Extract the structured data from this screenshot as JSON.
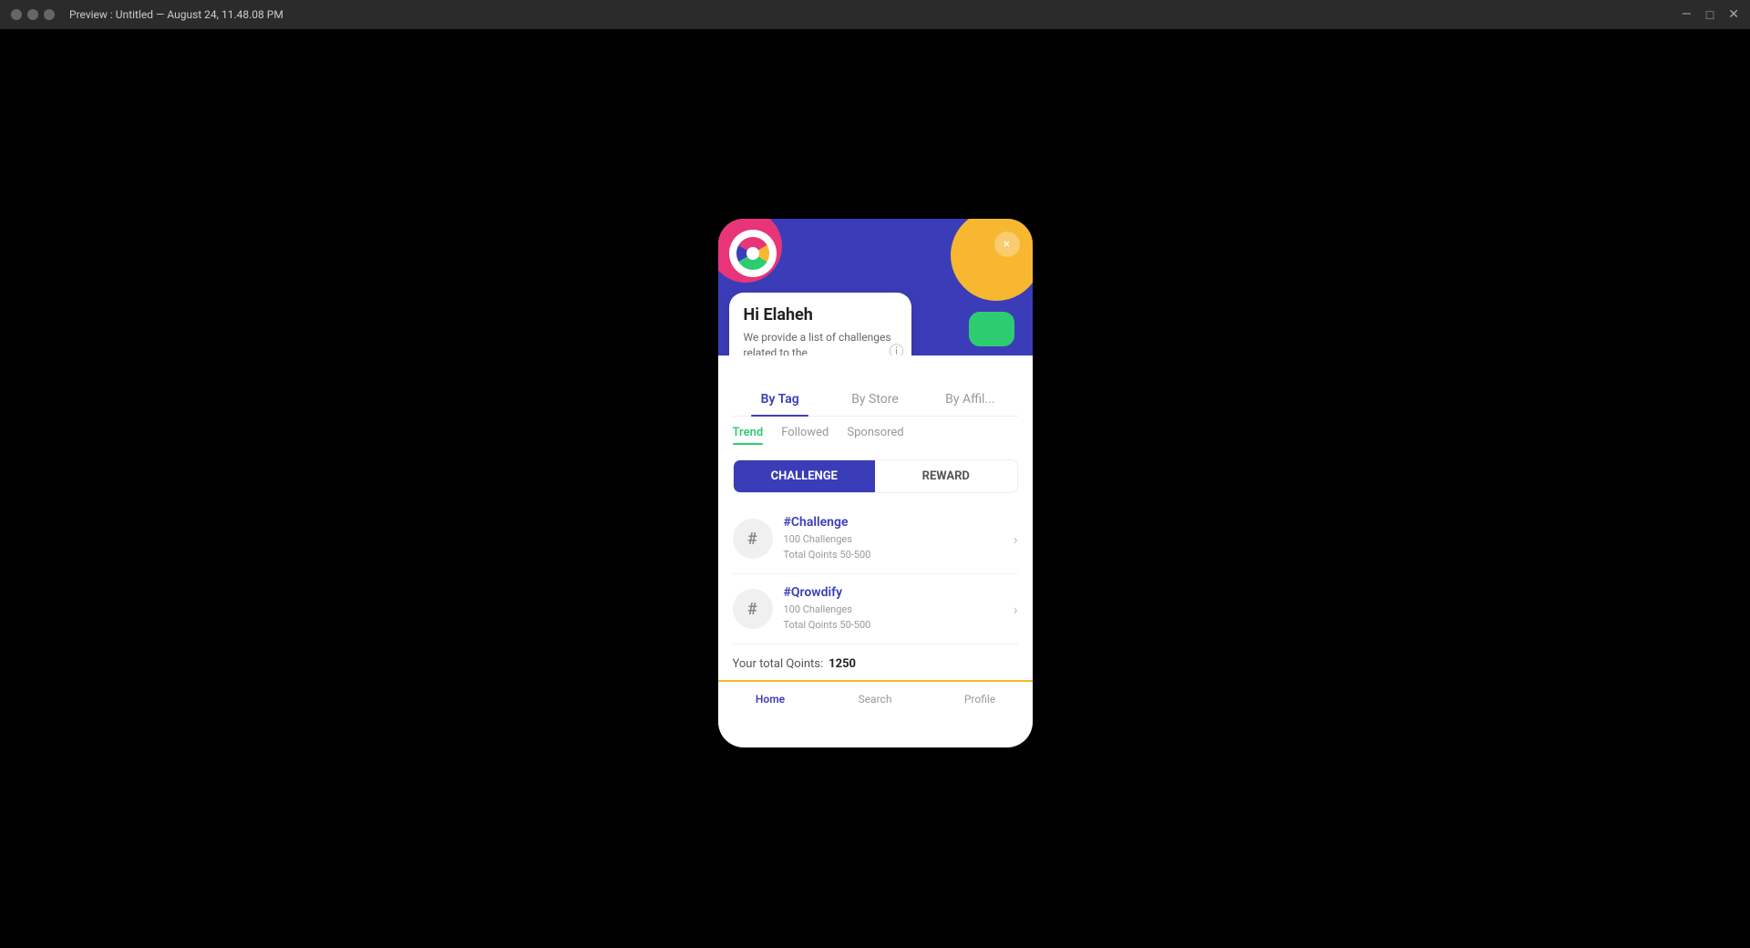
{
  "titleBar": {
    "title": "Preview : Untitled — August 24, 11.48.08 PM",
    "closeLabel": "✕",
    "minimizeLabel": "—",
    "maximizeLabel": "□"
  },
  "modal": {
    "closeButton": "×",
    "greeting": {
      "title": "Hi Elaheh",
      "text": "We provide a list of challenges related to the"
    },
    "mainTabs": [
      {
        "label": "By Tag",
        "active": true
      },
      {
        "label": "By Store",
        "active": false
      },
      {
        "label": "By Affil...",
        "active": false
      }
    ],
    "subTabs": [
      {
        "label": "Trend",
        "active": true
      },
      {
        "label": "Followed",
        "active": false
      },
      {
        "label": "Sponsored",
        "active": false
      }
    ],
    "toggleButtons": [
      {
        "label": "CHALLENGE",
        "active": true
      },
      {
        "label": "REWARD",
        "active": false
      }
    ],
    "challenges": [
      {
        "icon": "#",
        "name": "#Challenge",
        "challenges": "100 Challenges",
        "qoints": "Total Qoints 50-500"
      },
      {
        "icon": "#",
        "name": "#Qrowdify",
        "challenges": "100 Challenges",
        "qoints": "Total Qoints 50-500"
      }
    ],
    "totalQoints": {
      "label": "Your total Qoints:",
      "value": "1250"
    },
    "bottomNav": [
      {
        "label": "Home",
        "active": true
      },
      {
        "label": "Search",
        "active": false
      },
      {
        "label": "Profile",
        "active": false
      }
    ]
  }
}
